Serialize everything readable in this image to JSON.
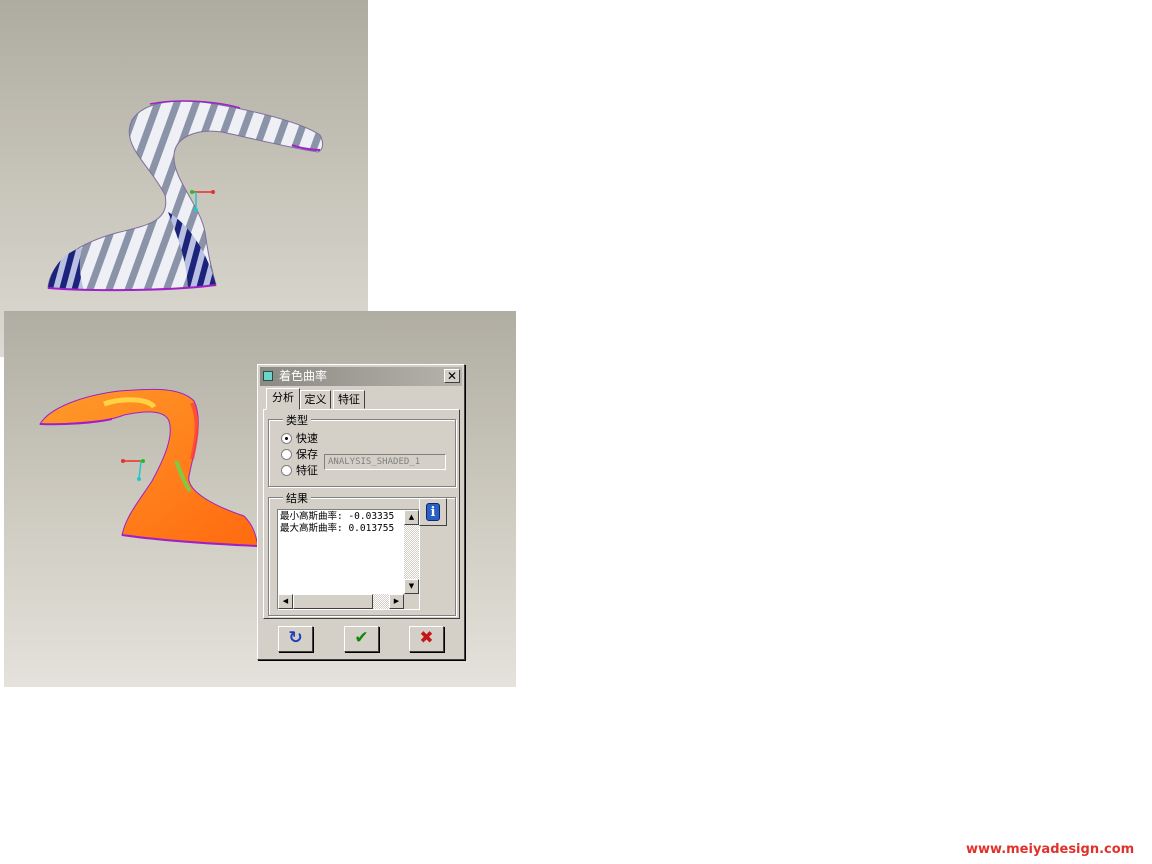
{
  "dialog": {
    "title": "着色曲率",
    "close_label": "✕",
    "tabs": [
      {
        "label": "分析",
        "active": true
      },
      {
        "label": "定义",
        "active": false
      },
      {
        "label": "特征",
        "active": false
      }
    ],
    "type_group": {
      "label": "类型",
      "options": [
        {
          "label": "快速",
          "selected": true
        },
        {
          "label": "保存",
          "selected": false
        },
        {
          "label": "特征",
          "selected": false
        }
      ],
      "save_name": "ANALYSIS_SHADED_1"
    },
    "results_group": {
      "label": "结果",
      "lines": [
        "最小高斯曲率: -0.03335",
        "最大高斯曲率: 0.013755"
      ]
    },
    "buttons": {
      "repeat": "↻",
      "ok": "✔",
      "cancel": "✖"
    }
  },
  "colors": {
    "ok_green": "#0d8a0d",
    "cancel_red": "#c41818",
    "repeat_blue": "#1e3fb5",
    "surface_orange": "#ff7a1a",
    "edge_purple": "#a020c8"
  },
  "watermark": "www.meiyadesign.com"
}
